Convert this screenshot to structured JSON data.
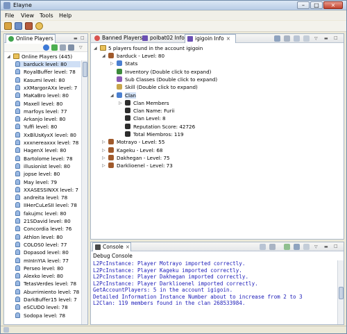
{
  "window": {
    "title": "Elayne",
    "minimize": "–",
    "maximize": "□",
    "close": "×"
  },
  "menu": [
    "File",
    "View",
    "Tools",
    "Help"
  ],
  "left_panel": {
    "tab_label": "Online Players",
    "header": "Online Players (445)",
    "players": [
      "barduck level: 80",
      "RoyalBuffer level: 78",
      "Kasumi level: 80",
      "xXMargorAXx level: 7",
      "MaKaBro level: 80",
      "Maxell level: 80",
      "marfoys level: 77",
      "Arkanjo level: 80",
      "Yuffi level: 80",
      "XxBlUsKyxX level: 80",
      "xxxnereaxxx level: 78",
      "HagenX level: 80",
      "Bartolome level: 78",
      "illusionist level: 80",
      "jopse level: 80",
      "May level: 79",
      "XXASESSINXX level: 7",
      "andreita level: 78",
      "IIHerCuLeSII level: 78",
      "fakujmc level: 80",
      "21SDavid level: 80",
      "Concordia level: 76",
      "Athlon level: 80",
      "COLOS0 level: 77",
      "Dopasod level: 80",
      "mInInYIA level: 77",
      "Perseo level: 80",
      "Alexko level: 80",
      "TetasVerdes level: 78",
      "Aburrimiento level: 78",
      "DarkBuffer15 level: 7",
      "eSCUDO level: 78",
      "Sodopa level: 78"
    ]
  },
  "editor": {
    "tabs": [
      {
        "label": "Banned Players",
        "color": "#d9534f"
      },
      {
        "label": "polbat02 Info",
        "color": "#6a4fb3"
      },
      {
        "label": "igigoin Info",
        "color": "#6a4fb3"
      }
    ],
    "root": "5 players found in the account igigoin",
    "tree": [
      {
        "label": "barduck - Level: 80",
        "indent": 1,
        "expander": "◢"
      },
      {
        "label": "Stats",
        "indent": 2,
        "expander": "▷"
      },
      {
        "label": "Inventory (Double click to expand)",
        "indent": 2,
        "expander": ""
      },
      {
        "label": "Sub Classes (Double click to expand)",
        "indent": 2,
        "expander": ""
      },
      {
        "label": "Skill (Double click to expand)",
        "indent": 2,
        "expander": ""
      },
      {
        "label": "Clan",
        "indent": 2,
        "expander": "◢"
      },
      {
        "label": "Clan Members",
        "indent": 3,
        "expander": "▷"
      },
      {
        "label": "Clan Name: Furii",
        "indent": 3,
        "expander": ""
      },
      {
        "label": "Clan Level: 8",
        "indent": 3,
        "expander": ""
      },
      {
        "label": "Reputation Score: 42726",
        "indent": 3,
        "expander": ""
      },
      {
        "label": "Total Miembros: 119",
        "indent": 3,
        "expander": ""
      },
      {
        "label": "Motrayo - Level: 55",
        "indent": 1,
        "expander": "▷"
      },
      {
        "label": "Kageku - Level: 68",
        "indent": 1,
        "expander": "▷"
      },
      {
        "label": "Dakhegan - Level: 75",
        "indent": 1,
        "expander": "▷"
      },
      {
        "label": "Darklioenel - Level: 73",
        "indent": 1,
        "expander": "▷"
      }
    ]
  },
  "console": {
    "tab_label": "Console",
    "subtitle": "Debug Console",
    "lines": [
      "L2PcInstance: Player Motrayo imported correctly.",
      "L2PcInstance: Player Kageku imported correctly.",
      "L2PcInstance: Player Dakhegan imported correctly.",
      "L2PcInstance: Player Darklioenel imported correctly.",
      "GetAccountPlayers: 5 in the account igigoin.",
      "Detailed Information Instance Number about to increase from 2 to 3",
      "L2Clan: 119 members found in the clan 268533984."
    ]
  }
}
